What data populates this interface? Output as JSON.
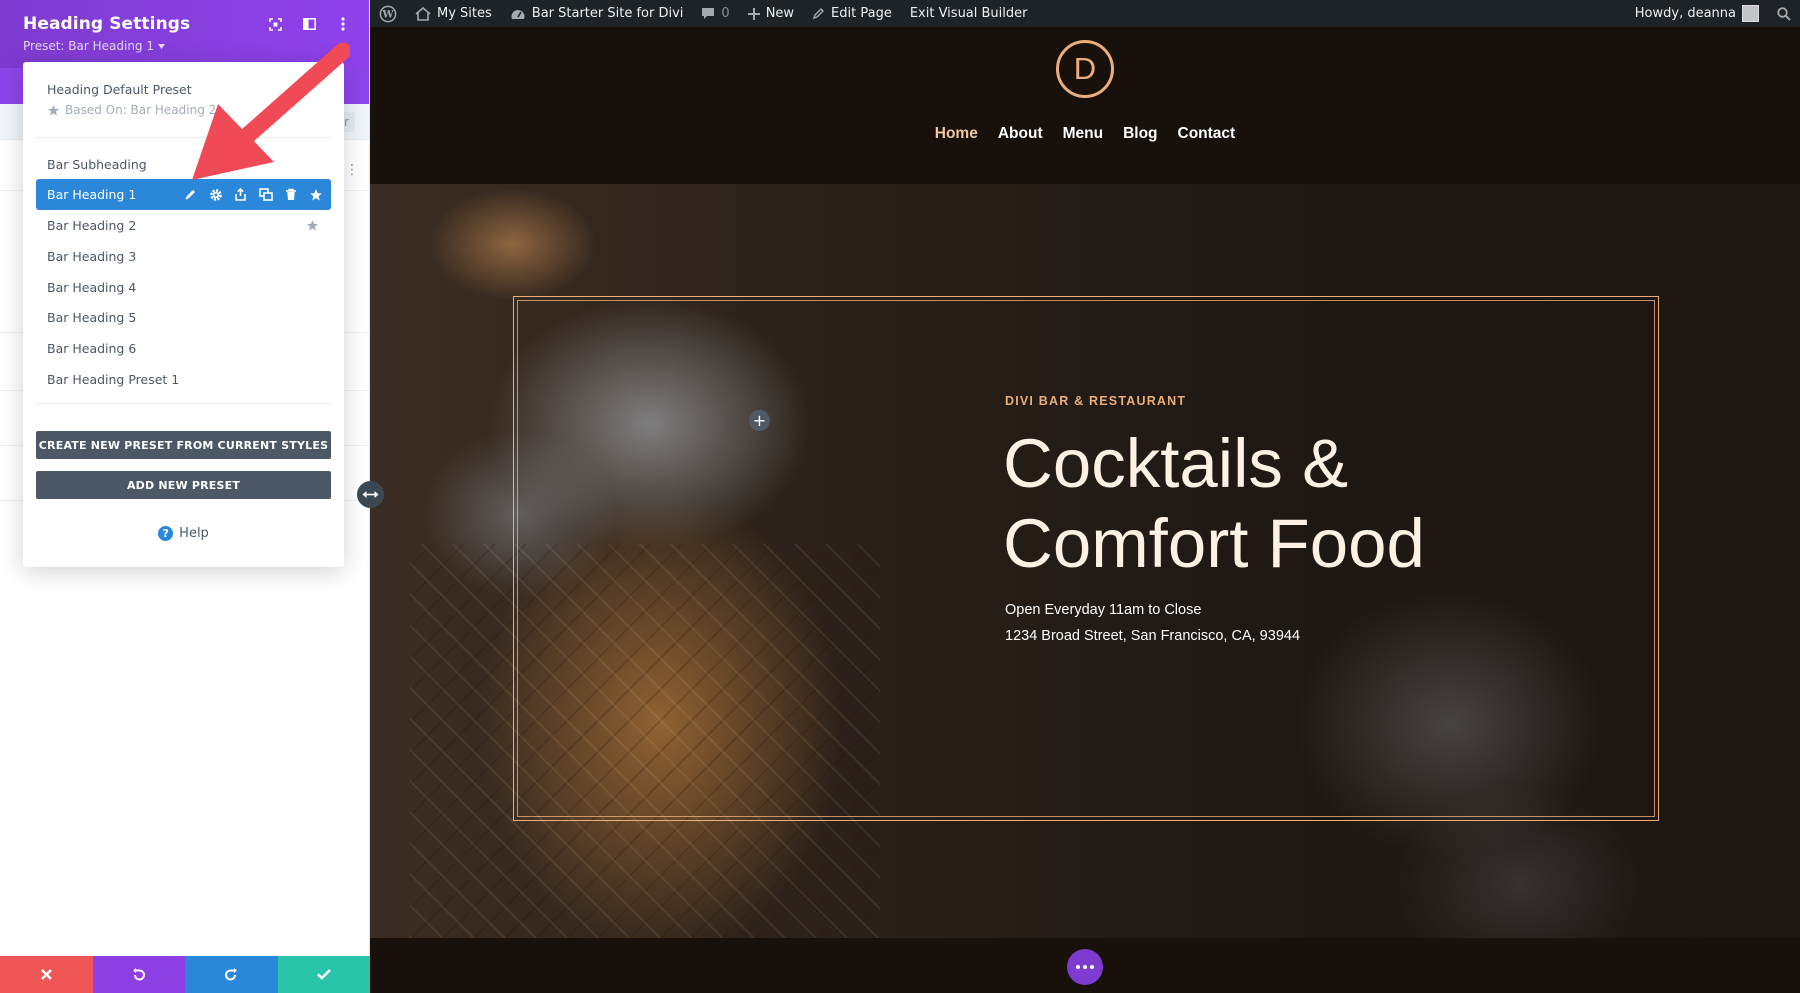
{
  "admin_bar": {
    "my_sites": "My Sites",
    "site_name": "Bar Starter Site for Divi",
    "comments_count": "0",
    "new_label": "New",
    "edit_page": "Edit Page",
    "exit_builder": "Exit Visual Builder",
    "greeting": "Howdy, deanna"
  },
  "panel": {
    "title": "Heading Settings",
    "preset_label": "Preset: Bar Heading 1",
    "filter_stub": "er"
  },
  "preset_menu": {
    "default_title": "Heading Default Preset",
    "default_based_on": "Based On: Bar Heading 2",
    "items": [
      {
        "label": "Bar Subheading"
      },
      {
        "label": "Bar Heading 1",
        "active": true
      },
      {
        "label": "Bar Heading 2",
        "default": true
      },
      {
        "label": "Bar Heading 3"
      },
      {
        "label": "Bar Heading 4"
      },
      {
        "label": "Bar Heading 5"
      },
      {
        "label": "Bar Heading 6"
      },
      {
        "label": "Bar Heading Preset 1"
      }
    ],
    "create_button": "CREATE NEW PRESET FROM CURRENT STYLES",
    "add_button": "ADD NEW PRESET",
    "help": "Help",
    "help_icon_glyph": "?"
  },
  "site": {
    "logo_letter": "D",
    "nav": [
      "Home",
      "About",
      "Menu",
      "Blog",
      "Contact"
    ],
    "hero": {
      "eyebrow": "DIVI BAR & RESTAURANT",
      "title_line1": "Cocktails &",
      "title_line2": "Comfort Food",
      "line1": "Open Everyday 11am to Close",
      "line2": "1234 Broad Street, San Francisco, CA, 93944"
    }
  },
  "colors": {
    "panel_header": "#8f42ec",
    "active_preset": "#2b87da",
    "accent_gold": "#e9ae7c",
    "footer_close": "#ef5555",
    "footer_undo": "#8c3fe2",
    "footer_redo": "#2b87da",
    "footer_save": "#29c4a9"
  }
}
